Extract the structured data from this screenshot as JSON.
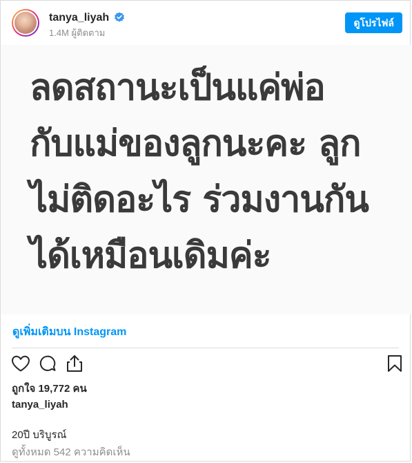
{
  "header": {
    "username": "tanya_liyah",
    "followers": "1.4M ผู้ติดตาม",
    "profile_button": "ดูโปรไฟล์"
  },
  "post": {
    "text_lines": [
      "ลดสถานะเป็นแค่พ่อ",
      "กับแม่ของลูกนะคะ ลูก",
      "ไม่ติดอะไร ร่วมงานกัน",
      "ได้เหมือนเดิมค่ะ"
    ],
    "more_link": "ดูเพิ่มเติมบน Instagram"
  },
  "actions": {
    "icons": [
      "heart-icon",
      "comment-icon",
      "share-icon",
      "bookmark-icon"
    ]
  },
  "engagement": {
    "likes": "ถูกใจ 19,772 คน",
    "caption_user": "tanya_liyah",
    "caption": "20ปี บริบูรณ์",
    "comments": "ดูทั้งหมด 542 ความคิดเห็น"
  },
  "colors": {
    "accent": "#0095f6",
    "text": "#262626",
    "muted": "#8e8e8e",
    "border": "#dbdbdb"
  }
}
